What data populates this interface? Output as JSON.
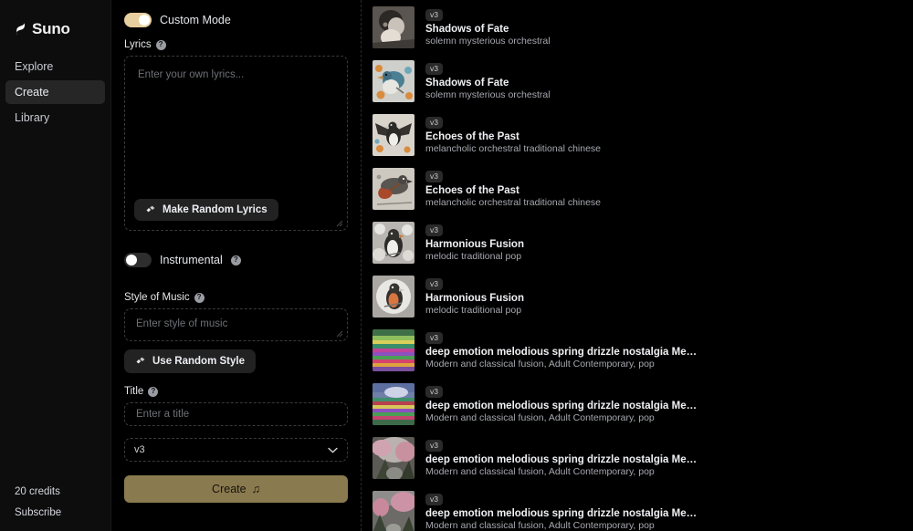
{
  "sidebar": {
    "brand": "Suno",
    "brand_icon": "suno-logo-icon",
    "items": [
      {
        "label": "Explore",
        "active": false
      },
      {
        "label": "Create",
        "active": true
      },
      {
        "label": "Library",
        "active": false
      }
    ],
    "credits": "20 credits",
    "subscribe": "Subscribe"
  },
  "form": {
    "custom_mode": {
      "label": "Custom Mode",
      "on": true
    },
    "lyrics": {
      "label": "Lyrics",
      "help_icon": "help-circle-icon",
      "placeholder": "Enter your own lyrics...",
      "value": "",
      "random_button": "Make Random Lyrics",
      "random_button_icon": "dice-icon"
    },
    "instrumental": {
      "label": "Instrumental",
      "on": false,
      "help_icon": "help-circle-icon"
    },
    "style": {
      "label": "Style of Music",
      "help_icon": "help-circle-icon",
      "placeholder": "Enter style of music",
      "value": "",
      "random_button": "Use Random Style",
      "random_button_icon": "dice-icon"
    },
    "title": {
      "label": "Title",
      "help_icon": "help-circle-icon",
      "placeholder": "Enter a title",
      "value": ""
    },
    "version_select": {
      "value": "v3",
      "icon": "chevron-down-icon"
    },
    "create_button": {
      "label": "Create",
      "icon": "music-note-icon",
      "color": "#8a7a4f"
    }
  },
  "songs": [
    {
      "badge": "v3",
      "title": "Shadows of Fate",
      "tags": "solemn mysterious orchestral",
      "art": "bird-grayscale-portrait"
    },
    {
      "badge": "v3",
      "title": "Shadows of Fate",
      "tags": "solemn mysterious orchestral",
      "art": "bluebird-floral"
    },
    {
      "badge": "v3",
      "title": "Echoes of the Past",
      "tags": "melancholic orchestral traditional chinese",
      "art": "magpie-wings-spread"
    },
    {
      "badge": "v3",
      "title": "Echoes of the Past",
      "tags": "melancholic orchestral traditional chinese",
      "art": "bird-with-guitar"
    },
    {
      "badge": "v3",
      "title": "Harmonious Fusion",
      "tags": "melodic traditional pop",
      "art": "penguin-monochrome"
    },
    {
      "badge": "v3",
      "title": "Harmonious Fusion",
      "tags": "melodic traditional pop",
      "art": "robin-orange-breast"
    },
    {
      "badge": "v3",
      "title": "deep emotion melodious spring drizzle nostalgia Memory e...",
      "tags": "Modern and classical fusion,  Adult Contemporary,  pop",
      "art": "rainbow-fields-landscape"
    },
    {
      "badge": "v3",
      "title": "deep emotion melodious spring drizzle nostalgia Memory e...",
      "tags": "Modern and classical fusion,  Adult Contemporary,  pop",
      "art": "rainbow-fields-sunset"
    },
    {
      "badge": "v3",
      "title": "deep emotion melodious spring drizzle nostalgia Memory e...",
      "tags": "Modern and classical fusion,  Adult Contemporary,  pop",
      "art": "cherry-blossom-path-misty"
    },
    {
      "badge": "v3",
      "title": "deep emotion melodious spring drizzle nostalgia Memory e...",
      "tags": "Modern and classical fusion,  Adult Contemporary,  pop",
      "art": "cherry-blossom-path-pink"
    }
  ]
}
